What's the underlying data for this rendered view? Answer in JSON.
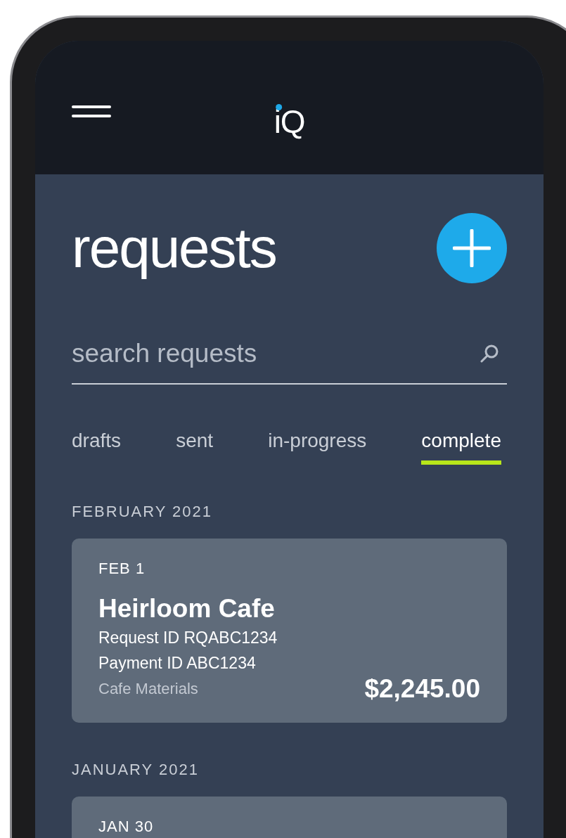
{
  "app_bar": {
    "logo": "iQ"
  },
  "title": "requests",
  "search": {
    "placeholder": "search requests"
  },
  "tabs": [
    {
      "label": "drafts",
      "selected": false
    },
    {
      "label": "sent",
      "selected": false
    },
    {
      "label": "in-progress",
      "selected": false
    },
    {
      "label": "complete",
      "selected": true
    }
  ],
  "sections": [
    {
      "heading": "FEBRUARY 2021",
      "requests": [
        {
          "date": "FEB 1",
          "name": "Heirloom Cafe",
          "request_id": "Request ID RQABC1234",
          "payment_id": "Payment ID ABC1234",
          "category": "Cafe Materials",
          "amount": "$2,245.00"
        }
      ]
    },
    {
      "heading": "JANUARY 2021",
      "requests": [
        {
          "date": "JAN 30"
        }
      ]
    }
  ]
}
